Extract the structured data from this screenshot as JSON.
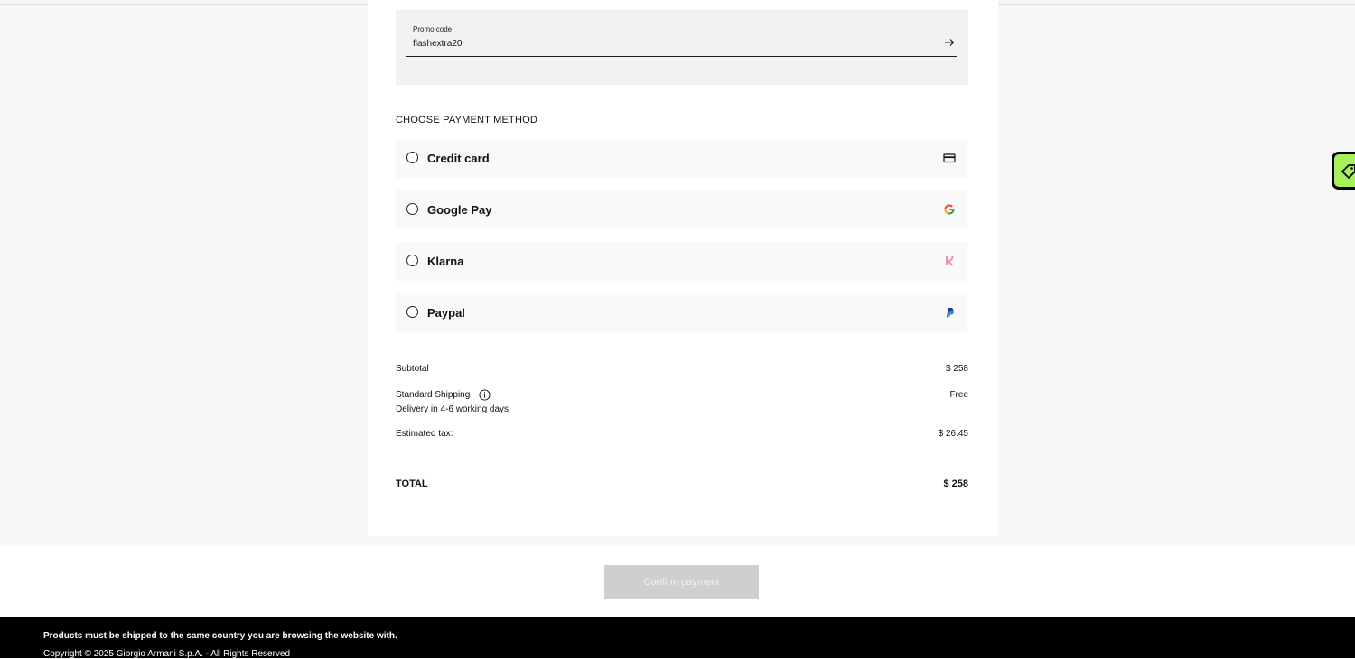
{
  "promo": {
    "label": "Promo code",
    "value": "flashextra20",
    "submit_icon": "arrow-right-icon"
  },
  "payment": {
    "section_title": "CHOOSE PAYMENT METHOD",
    "methods": [
      {
        "label": "Credit card",
        "icon": "credit-card-icon",
        "selected": false
      },
      {
        "label": "Google Pay",
        "icon": "google-icon",
        "selected": false
      },
      {
        "label": "Klarna",
        "icon": "klarna-icon",
        "selected": false
      },
      {
        "label": "Paypal",
        "icon": "paypal-icon",
        "selected": false
      }
    ]
  },
  "summary": {
    "subtotal_label": "Subtotal",
    "subtotal_value": "$ 258",
    "shipping_label": "Standard Shipping",
    "shipping_value": "Free",
    "shipping_note": "Delivery in 4-6 working days",
    "tax_label": "Estimated tax:",
    "tax_value": "$ 26.45",
    "total_label": "TOTAL",
    "total_value": "$ 258"
  },
  "actions": {
    "confirm_label": "Confirm payment"
  },
  "footer": {
    "note": "Products must be shipped to the same country you are browsing the website with.",
    "copyright": "Copyright © 2025 Giorgio Armani S.p.A. - All Rights Reserved"
  },
  "colors": {
    "confirm_disabled": "#cfcfcf",
    "side_tab": "#a6f05a",
    "klarna": "#ef8fb1",
    "paypal_dark": "#253b80",
    "paypal_light": "#179bd7"
  }
}
